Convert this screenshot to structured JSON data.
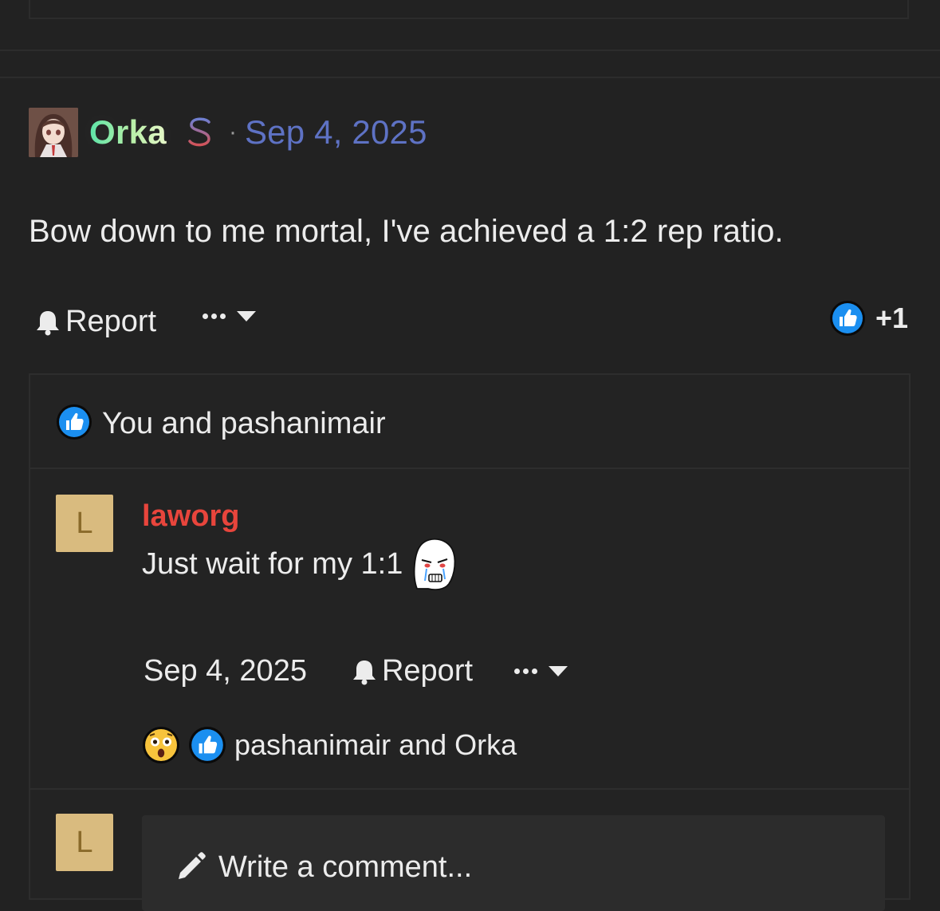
{
  "post": {
    "author": "Orka",
    "date": "Sep 4, 2025",
    "separator": "·",
    "body": "Bow down to me mortal, I've achieved a 1:2 rep ratio.",
    "actions": {
      "report_label": "Report",
      "reaction_score": "+1"
    },
    "reactions_summary": "You and pashanimair"
  },
  "comment": {
    "avatar_letter": "L",
    "author": "laworg",
    "text": "Just wait for my 1:1",
    "date": "Sep 4, 2025",
    "report_label": "Report",
    "reactions_summary": "pashanimair and Orka"
  },
  "composer": {
    "avatar_letter": "L",
    "placeholder": "Write a comment..."
  },
  "colors": {
    "background": "#222222",
    "author_gradient": [
      "#5be3a6",
      "#e6f7c8"
    ],
    "date_link": "#5e72c4",
    "comment_author": "#e8453c",
    "avatar_letter_bg": "#d9bb7f",
    "like_blue": "#1b8ff0"
  },
  "icons": [
    "dollar-icon",
    "bell-icon",
    "more-dots-icon",
    "caret-down-icon",
    "like-icon",
    "shocked-emoji-icon",
    "wojak-emoji-icon",
    "pencil-icon"
  ]
}
